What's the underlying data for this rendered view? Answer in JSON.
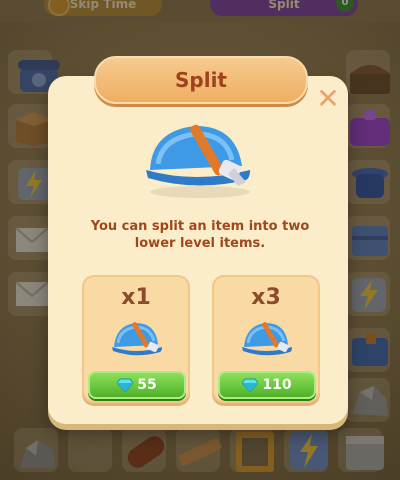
{
  "top_bar": {
    "left_label": "Skip Time",
    "right_label": "Split",
    "right_badge": "0"
  },
  "dialog": {
    "title": "Split",
    "close_symbol": "✕",
    "description": "You can split an item into two lower level items.",
    "item_icon": "blue-hard-hat-with-hammer-icon",
    "options": [
      {
        "quantity": "x1",
        "price": "55",
        "currency_icon": "diamond-icon"
      },
      {
        "quantity": "x3",
        "price": "110",
        "currency_icon": "diamond-icon"
      }
    ]
  },
  "colors": {
    "dialog_bg": "#fbedc9",
    "title_text": "#a0431c",
    "price_button": "#5cc232",
    "helmet_blue": "#3f9ae6"
  }
}
